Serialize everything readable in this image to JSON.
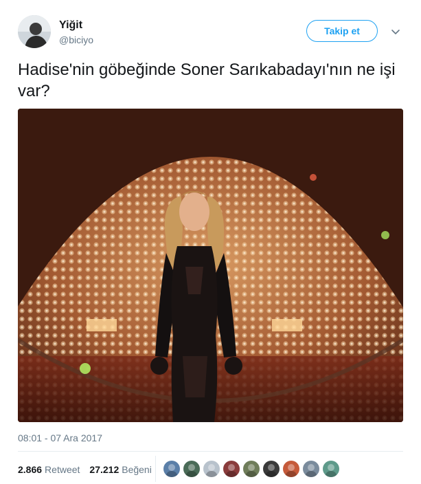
{
  "author": {
    "display_name": "Yiğit",
    "username": "@biciyo"
  },
  "follow_button": {
    "label": "Takip et",
    "color": "#1da1f2"
  },
  "tweet": {
    "text": "Hadise'nin göbeğinde Soner Sarıkabadayı'nın ne işi var?"
  },
  "meta": {
    "timestamp": "08:01 - 07 Ara 2017"
  },
  "stats": {
    "retweets_count": "2.866",
    "retweets_label": "Retweet",
    "likes_count": "27.212",
    "likes_label": "Beğeni"
  },
  "likers": [
    {
      "color": "#5b7fa8"
    },
    {
      "color": "#4a6b57"
    },
    {
      "color": "#b8c2cc"
    },
    {
      "color": "#8a3b3b"
    },
    {
      "color": "#6f7d5a"
    },
    {
      "color": "#3a3a3a"
    },
    {
      "color": "#c55a3a"
    },
    {
      "color": "#7a8b9c"
    },
    {
      "color": "#5e9a8a"
    }
  ],
  "icons": {
    "caret": "chevron-down-icon",
    "avatar": "user-avatar"
  }
}
